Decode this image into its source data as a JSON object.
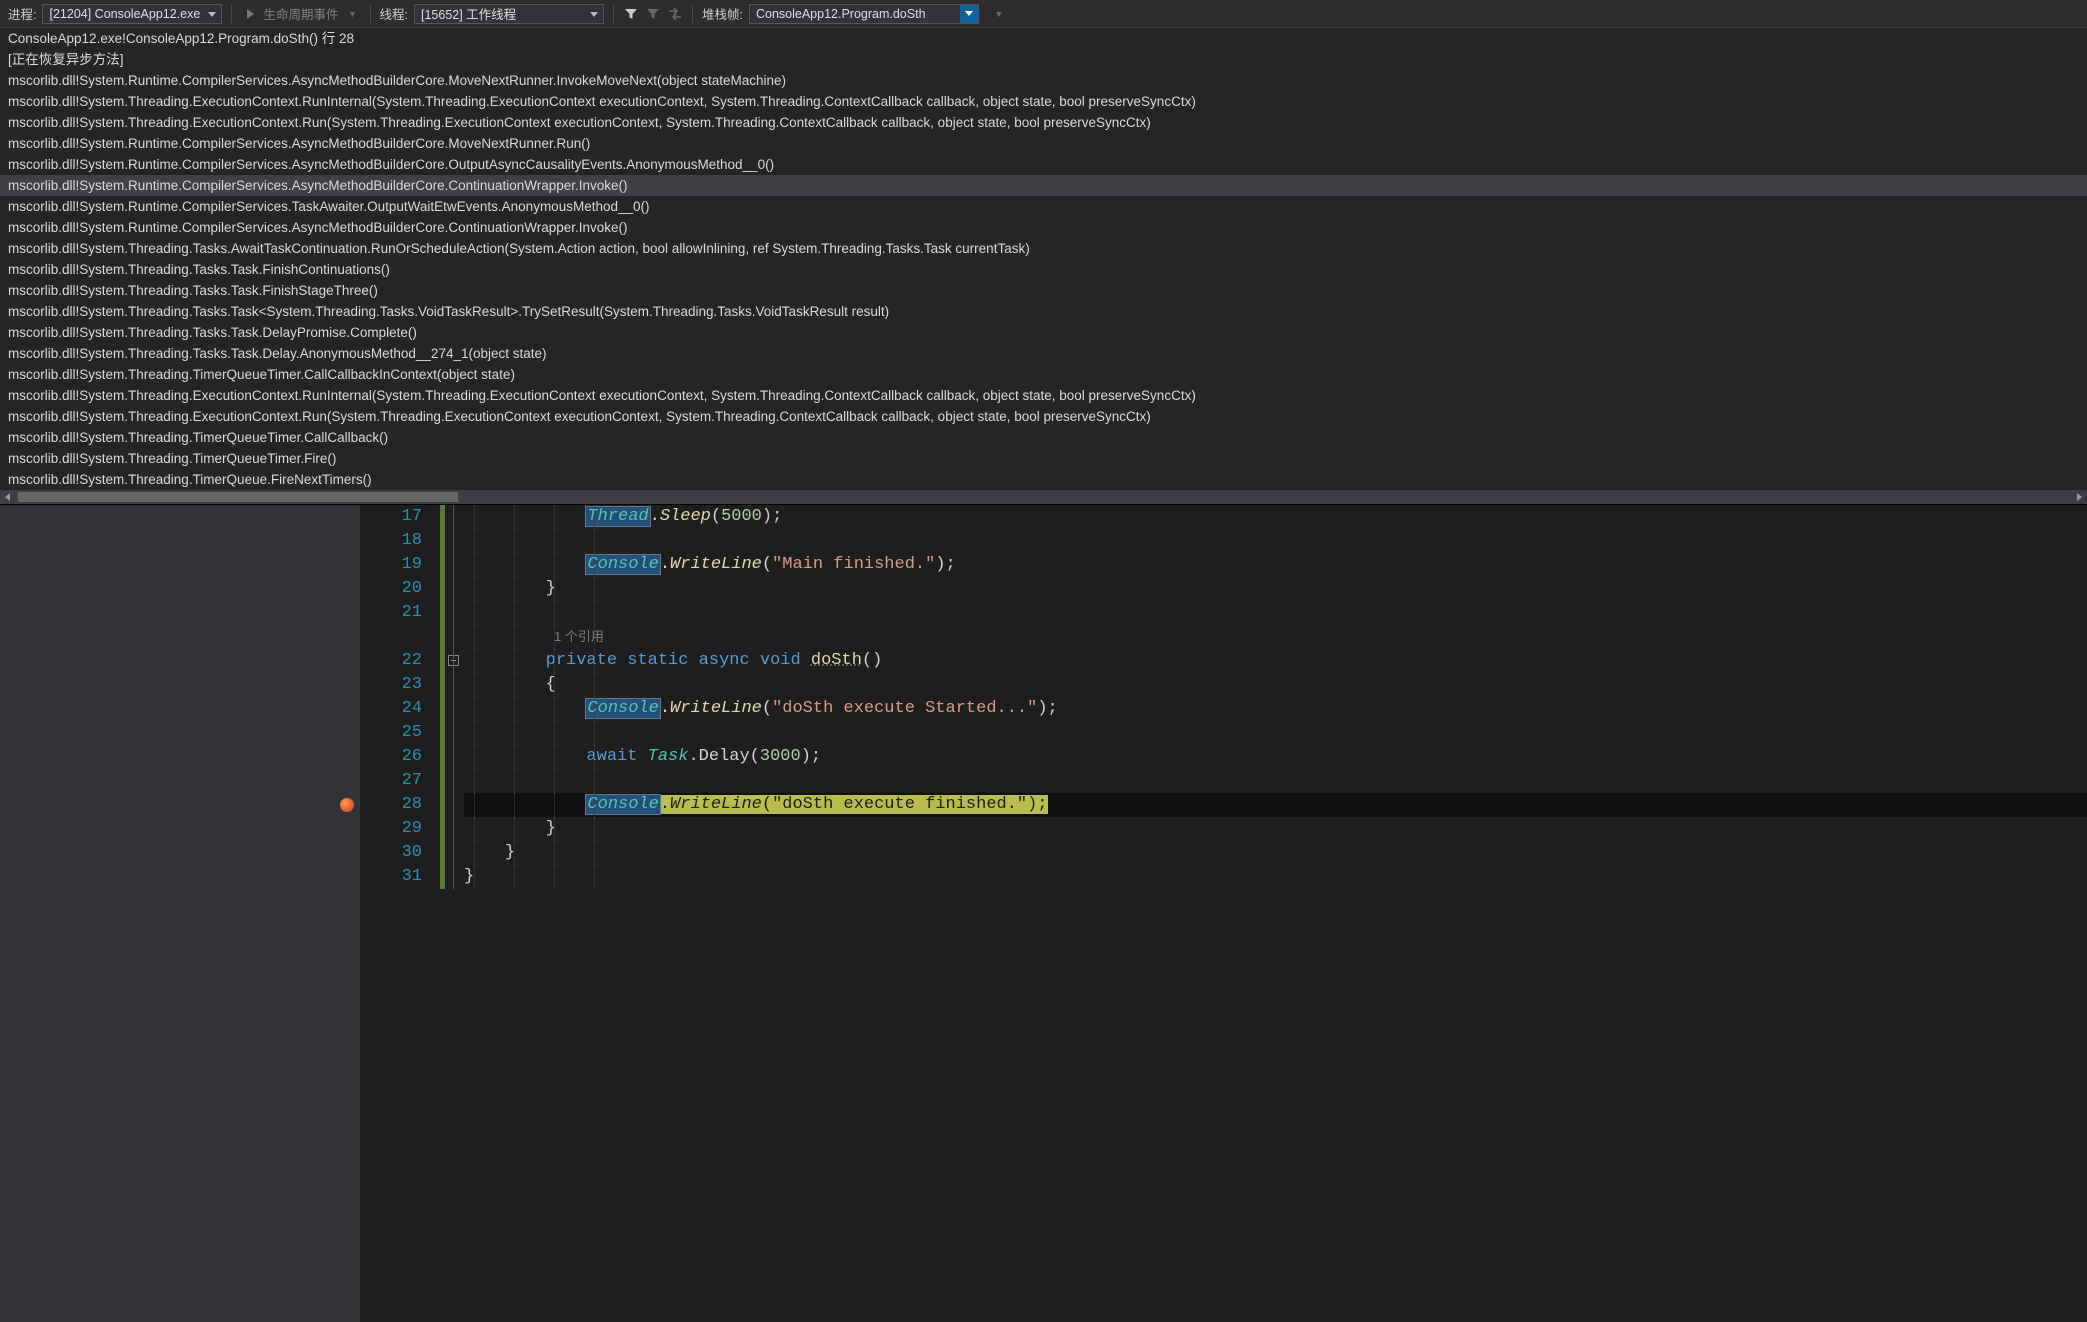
{
  "toolbar": {
    "process_label": "进程:",
    "process_value": "[21204] ConsoleApp12.exe",
    "lifecycle_label": "生命周期事件",
    "thread_label": "线程:",
    "thread_value": "[15652] 工作线程",
    "stackframe_label": "堆栈帧:",
    "stackframe_value": "ConsoleApp12.Program.doSth"
  },
  "callstack": [
    {
      "t": "ConsoleApp12.exe!ConsoleApp12.Program.doSth() 行 28",
      "sel": false
    },
    {
      "t": "[正在恢复异步方法]",
      "sel": false
    },
    {
      "t": "mscorlib.dll!System.Runtime.CompilerServices.AsyncMethodBuilderCore.MoveNextRunner.InvokeMoveNext(object stateMachine)",
      "sel": false
    },
    {
      "t": "mscorlib.dll!System.Threading.ExecutionContext.RunInternal(System.Threading.ExecutionContext executionContext, System.Threading.ContextCallback callback, object state, bool preserveSyncCtx)",
      "sel": false
    },
    {
      "t": "mscorlib.dll!System.Threading.ExecutionContext.Run(System.Threading.ExecutionContext executionContext, System.Threading.ContextCallback callback, object state, bool preserveSyncCtx)",
      "sel": false
    },
    {
      "t": "mscorlib.dll!System.Runtime.CompilerServices.AsyncMethodBuilderCore.MoveNextRunner.Run()",
      "sel": false
    },
    {
      "t": "mscorlib.dll!System.Runtime.CompilerServices.AsyncMethodBuilderCore.OutputAsyncCausalityEvents.AnonymousMethod__0()",
      "sel": false
    },
    {
      "t": "mscorlib.dll!System.Runtime.CompilerServices.AsyncMethodBuilderCore.ContinuationWrapper.Invoke()",
      "sel": true
    },
    {
      "t": "mscorlib.dll!System.Runtime.CompilerServices.TaskAwaiter.OutputWaitEtwEvents.AnonymousMethod__0()",
      "sel": false
    },
    {
      "t": "mscorlib.dll!System.Runtime.CompilerServices.AsyncMethodBuilderCore.ContinuationWrapper.Invoke()",
      "sel": false
    },
    {
      "t": "mscorlib.dll!System.Threading.Tasks.AwaitTaskContinuation.RunOrScheduleAction(System.Action action, bool allowInlining, ref System.Threading.Tasks.Task currentTask)",
      "sel": false
    },
    {
      "t": "mscorlib.dll!System.Threading.Tasks.Task.FinishContinuations()",
      "sel": false
    },
    {
      "t": "mscorlib.dll!System.Threading.Tasks.Task.FinishStageThree()",
      "sel": false
    },
    {
      "t": "mscorlib.dll!System.Threading.Tasks.Task<System.Threading.Tasks.VoidTaskResult>.TrySetResult(System.Threading.Tasks.VoidTaskResult result)",
      "sel": false
    },
    {
      "t": "mscorlib.dll!System.Threading.Tasks.Task.DelayPromise.Complete()",
      "sel": false
    },
    {
      "t": "mscorlib.dll!System.Threading.Tasks.Task.Delay.AnonymousMethod__274_1(object state)",
      "sel": false
    },
    {
      "t": "mscorlib.dll!System.Threading.TimerQueueTimer.CallCallbackInContext(object state)",
      "sel": false
    },
    {
      "t": "mscorlib.dll!System.Threading.ExecutionContext.RunInternal(System.Threading.ExecutionContext executionContext, System.Threading.ContextCallback callback, object state, bool preserveSyncCtx)",
      "sel": false
    },
    {
      "t": "mscorlib.dll!System.Threading.ExecutionContext.Run(System.Threading.ExecutionContext executionContext, System.Threading.ContextCallback callback, object state, bool preserveSyncCtx)",
      "sel": false
    },
    {
      "t": "mscorlib.dll!System.Threading.TimerQueueTimer.CallCallback()",
      "sel": false
    },
    {
      "t": "mscorlib.dll!System.Threading.TimerQueueTimer.Fire()",
      "sel": false
    },
    {
      "t": "mscorlib.dll!System.Threading.TimerQueue.FireNextTimers()",
      "sel": false
    }
  ],
  "codelens": "1 个引用",
  "lines": [
    {
      "n": 17,
      "kind": "code",
      "tokens": [
        [
          "pad",
          "            "
        ],
        [
          "box",
          "Thread"
        ],
        [
          "punc",
          "."
        ],
        [
          "method-y",
          "Sleep"
        ],
        [
          "punc",
          "("
        ],
        [
          "num",
          "5000"
        ],
        [
          "punc",
          ")"
        ],
        [
          "punc",
          ";"
        ]
      ]
    },
    {
      "n": 18,
      "kind": "blank"
    },
    {
      "n": 19,
      "kind": "code",
      "tokens": [
        [
          "pad",
          "            "
        ],
        [
          "box",
          "Console"
        ],
        [
          "punc",
          "."
        ],
        [
          "method-y",
          "WriteLine"
        ],
        [
          "punc",
          "("
        ],
        [
          "str",
          "\"Main finished.\""
        ],
        [
          "punc",
          ")"
        ],
        [
          "punc",
          ";"
        ]
      ]
    },
    {
      "n": 20,
      "kind": "code",
      "tokens": [
        [
          "pad",
          "        "
        ],
        [
          "punc",
          "}"
        ]
      ]
    },
    {
      "n": 21,
      "kind": "blank"
    },
    {
      "n": 0,
      "kind": "codelens"
    },
    {
      "n": 22,
      "kind": "code",
      "fold": true,
      "tokens": [
        [
          "pad",
          "        "
        ],
        [
          "kw",
          "private"
        ],
        [
          "pad",
          " "
        ],
        [
          "kw",
          "static"
        ],
        [
          "pad",
          " "
        ],
        [
          "kw",
          "async"
        ],
        [
          "pad",
          " "
        ],
        [
          "kw",
          "void"
        ],
        [
          "pad",
          " "
        ],
        [
          "fn",
          "doSth"
        ],
        [
          "punc",
          "("
        ],
        [
          "punc",
          ")"
        ]
      ]
    },
    {
      "n": 23,
      "kind": "code",
      "tokens": [
        [
          "pad",
          "        "
        ],
        [
          "punc",
          "{"
        ]
      ]
    },
    {
      "n": 24,
      "kind": "code",
      "tokens": [
        [
          "pad",
          "            "
        ],
        [
          "box",
          "Console"
        ],
        [
          "punc",
          "."
        ],
        [
          "method-y",
          "WriteLine"
        ],
        [
          "punc",
          "("
        ],
        [
          "str",
          "\"doSth execute Started...\""
        ],
        [
          "punc",
          ")"
        ],
        [
          "punc",
          ";"
        ]
      ]
    },
    {
      "n": 25,
      "kind": "blank"
    },
    {
      "n": 26,
      "kind": "code",
      "tokens": [
        [
          "pad",
          "            "
        ],
        [
          "kw",
          "await"
        ],
        [
          "pad",
          " "
        ],
        [
          "type",
          "Task"
        ],
        [
          "punc",
          "."
        ],
        [
          "plain",
          "Delay"
        ],
        [
          "punc",
          "("
        ],
        [
          "num",
          "3000"
        ],
        [
          "punc",
          ")"
        ],
        [
          "punc",
          ";"
        ]
      ]
    },
    {
      "n": 27,
      "kind": "blank"
    },
    {
      "n": 28,
      "kind": "step",
      "bp": true,
      "tokens": [
        [
          "pad",
          "            "
        ],
        [
          "box-step",
          "Console"
        ],
        [
          "step",
          "."
        ],
        [
          "step-i",
          "WriteLine"
        ],
        [
          "step",
          "("
        ],
        [
          "step",
          "\"doSth execute finished.\""
        ],
        [
          "step",
          ")"
        ],
        [
          "step",
          ";"
        ]
      ]
    },
    {
      "n": 29,
      "kind": "code",
      "tokens": [
        [
          "pad",
          "        "
        ],
        [
          "punc",
          "}"
        ]
      ]
    },
    {
      "n": 30,
      "kind": "code",
      "tokens": [
        [
          "pad",
          "    "
        ],
        [
          "punc",
          "}"
        ]
      ]
    },
    {
      "n": 31,
      "kind": "code",
      "tokens": [
        [
          "punc",
          "}"
        ]
      ]
    }
  ]
}
